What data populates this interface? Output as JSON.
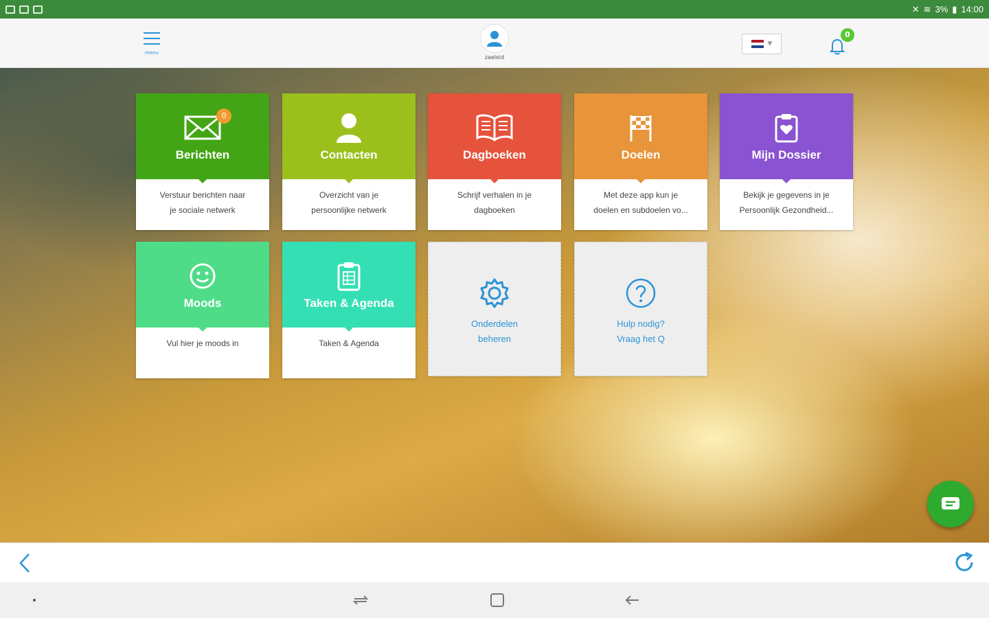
{
  "status_bar": {
    "time": "14:00",
    "battery": "3%"
  },
  "header": {
    "menu_label": "menu",
    "user_name": "zaeleid",
    "notification_count": "0",
    "language_flag": "nl"
  },
  "tiles": [
    {
      "title": "Berichten",
      "line1": "Verstuur berichten naar",
      "line2": "je sociale netwerk",
      "color": "#43a515",
      "badge": "0"
    },
    {
      "title": "Contacten",
      "line1": "Overzicht van je",
      "line2": "persoonlijke netwerk",
      "color": "#9bc01c"
    },
    {
      "title": "Dagboeken",
      "line1": "Schrijf verhalen in je",
      "line2": "dagboeken",
      "color": "#e5533d"
    },
    {
      "title": "Doelen",
      "line1": "Met deze app kun je",
      "line2": "doelen en subdoelen vo...",
      "color": "#e8943a"
    },
    {
      "title": "Mijn Dossier",
      "line1": "Bekijk je gegevens in je",
      "line2": "Persoonlijk Gezondheid...",
      "color": "#8a53d1"
    },
    {
      "title": "Moods",
      "line1": "Vul hier je moods in",
      "line2": "",
      "color": "#4fdc88"
    },
    {
      "title": "Taken & Agenda",
      "line1": "Taken & Agenda",
      "line2": "",
      "color": "#35dfb4"
    }
  ],
  "manage_tiles": [
    {
      "line1": "Onderdelen",
      "line2": "beheren"
    },
    {
      "line1": "Hulp nodig?",
      "line2": "Vraag het Q"
    }
  ]
}
